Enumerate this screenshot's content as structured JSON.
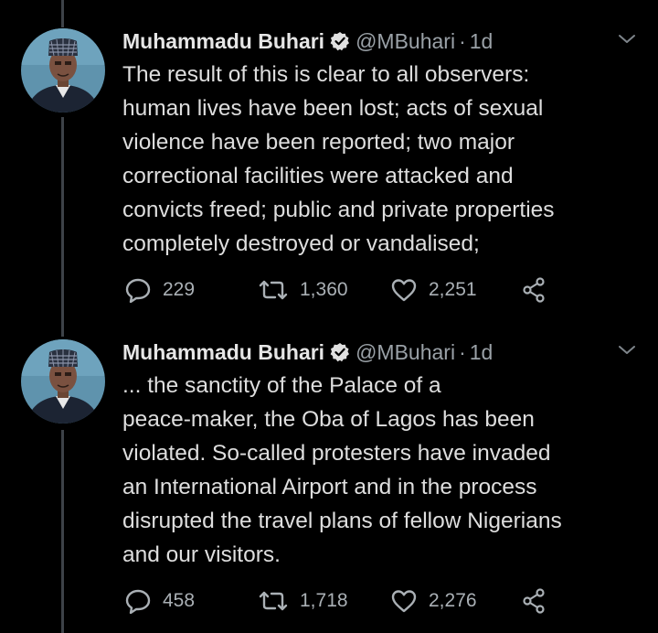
{
  "colors": {
    "background": "#000000",
    "text": "#dedede",
    "muted": "#9aa1a7",
    "verified": "#e0e0e0",
    "thread_line": "#3d4248"
  },
  "tweets": [
    {
      "name": "Muhammadu Buhari",
      "handle": "@MBuhari",
      "separator": "·",
      "time": "1d",
      "lines": [
        "The result of this is clear to all observers:",
        "human lives have been lost; acts of sexual",
        "violence have been reported; two major",
        "correctional facilities were attacked and",
        "convicts freed; public and private properties",
        "completely destroyed or vandalised;"
      ],
      "replies": "229",
      "retweets": "1,360",
      "likes": "2,251",
      "icons": [
        "reply-icon",
        "retweet-icon",
        "like-icon",
        "share-icon"
      ]
    },
    {
      "name": "Muhammadu Buhari",
      "handle": "@MBuhari",
      "separator": "·",
      "time": "1d",
      "lines": [
        "... the sanctity of the Palace of a",
        "peace-maker, the Oba of Lagos has been",
        "violated. So-called protesters have invaded",
        "an International Airport and in the process",
        "disrupted the travel plans of fellow Nigerians",
        "and our visitors."
      ],
      "replies": "458",
      "retweets": "1,718",
      "likes": "2,276",
      "icons": [
        "reply-icon",
        "retweet-icon",
        "like-icon",
        "share-icon"
      ]
    }
  ]
}
